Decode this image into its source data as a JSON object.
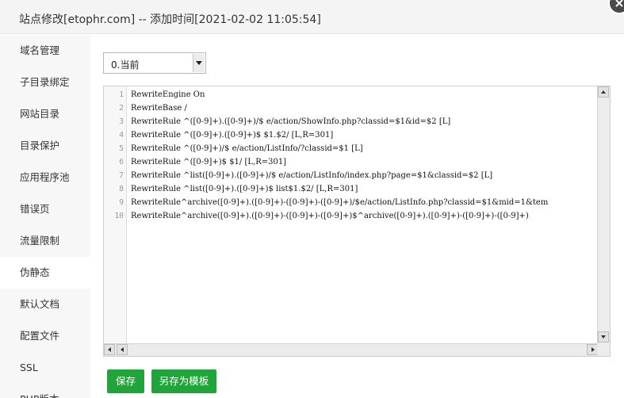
{
  "dialog": {
    "title": "站点修改[etophr.com] -- 添加时间[2021-02-02 11:05:54]"
  },
  "sidebar": {
    "items": [
      {
        "label": "域名管理",
        "active": false
      },
      {
        "label": "子目录绑定",
        "active": false
      },
      {
        "label": "网站目录",
        "active": false
      },
      {
        "label": "目录保护",
        "active": false
      },
      {
        "label": "应用程序池",
        "active": false
      },
      {
        "label": "错误页",
        "active": false
      },
      {
        "label": "流量限制",
        "active": false
      },
      {
        "label": "伪静态",
        "active": true
      },
      {
        "label": "默认文档",
        "active": false
      },
      {
        "label": "配置文件",
        "active": false
      },
      {
        "label": "SSL",
        "active": false
      },
      {
        "label": "PHP版本",
        "active": false
      }
    ]
  },
  "rewrite": {
    "select_value": "0.当前",
    "lines": [
      "RewriteEngine On",
      "RewriteBase /",
      "RewriteRule ^([0-9]+).([0-9]+)/$ e/action/ShowInfo.php?classid=$1&id=$2 [L]",
      "RewriteRule ^([0-9]+).([0-9]+)$ $1.$2/ [L,R=301]",
      "RewriteRule ^([0-9]+)/$ e/action/ListInfo/?classid=$1 [L]",
      "RewriteRule ^([0-9]+)$ $1/ [L,R=301]",
      "RewriteRule ^list([0-9]+).([0-9]+)/$ e/action/ListInfo/index.php?page=$1&classid=$2 [L]",
      "RewriteRule ^list([0-9]+).([0-9]+)$ list$1.$2/ [L,R=301]",
      "RewriteRule^archive([0-9]+).([0-9]+)-([0-9]+)-([0-9]+)/$e/action/ListInfo.php?classid=$1&mid=1&tem",
      "RewriteRule^archive([0-9]+).([0-9]+)-([0-9]+)-([0-9]+)$^archive([0-9]+).([0-9]+)-([0-9]+)-([0-9]+)"
    ]
  },
  "actions": {
    "save_label": "保存",
    "save_template_label": "另存为模板"
  },
  "colors": {
    "accent": "#20a53a"
  }
}
